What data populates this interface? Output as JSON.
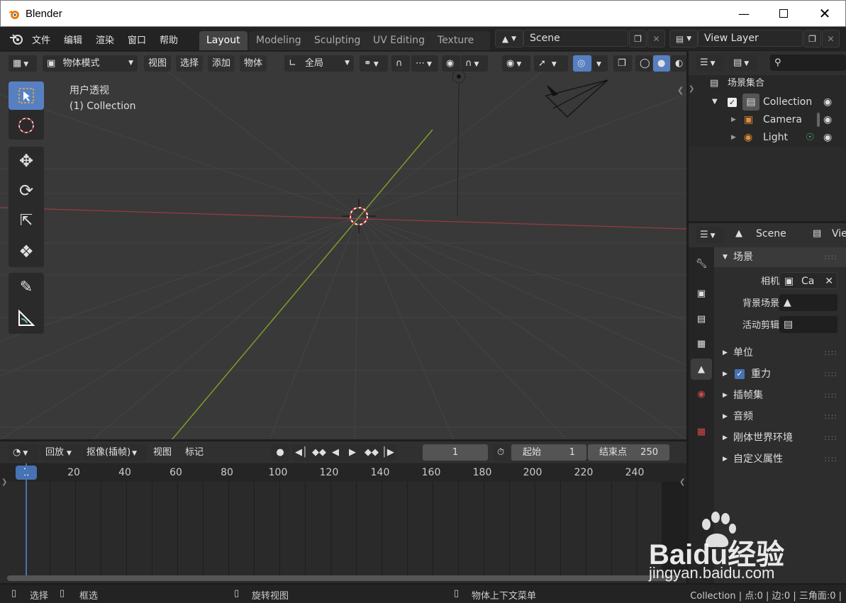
{
  "window": {
    "title": "Blender"
  },
  "menu": {
    "items": [
      "文件",
      "编辑",
      "渲染",
      "窗口",
      "帮助"
    ],
    "workspaces": [
      "Layout",
      "Modeling",
      "Sculpting",
      "UV Editing",
      "Texture Pa"
    ],
    "scene": "Scene",
    "view_layer": "View Layer"
  },
  "viewport": {
    "mode": "物体模式",
    "menus": [
      "视图",
      "选择",
      "添加",
      "物体"
    ],
    "transform_orientation": "全局",
    "view_name": "用户透视",
    "collection_label": "(1) Collection"
  },
  "timeline": {
    "menus": [
      "回放",
      "抠像(插帧)",
      "视图",
      "标记"
    ],
    "current_frame": "1",
    "start_label": "起始",
    "start_value": "1",
    "end_label": "结束点",
    "end_value": "250",
    "ruler_marker": "1",
    "ruler_ticks": [
      "20",
      "40",
      "60",
      "80",
      "100",
      "120",
      "140",
      "160",
      "180",
      "200",
      "220",
      "240"
    ]
  },
  "outliner": {
    "root": "场景集合",
    "collection": "Collection",
    "objects": [
      "Camera",
      "Light"
    ]
  },
  "properties": {
    "scene_name": "Scene",
    "view_layer_short": "Vie",
    "panel_title": "场景",
    "camera_label": "相机",
    "camera_value": "Ca",
    "background_label": "背景场景",
    "clip_label": "活动剪辑",
    "sections": [
      "单位",
      "重力",
      "插帧集",
      "音频",
      "刚体世界环境",
      "自定义属性"
    ]
  },
  "statusbar": {
    "select": "选择",
    "box_select": "框选",
    "rotate": "旋转视图",
    "context_menu": "物体上下文菜单",
    "stats": "Collection | 点:0 | 边:0 | 三角面:0 |"
  },
  "watermark": {
    "text": "Baidu经验",
    "url": "jingyan.baidu.com"
  },
  "colors": {
    "accent": "#5680c2",
    "x_axis": "#9c3a45",
    "y_axis": "#7d9d2b",
    "camera_icon": "#e08b3a",
    "checkbox": "#4772b3"
  }
}
